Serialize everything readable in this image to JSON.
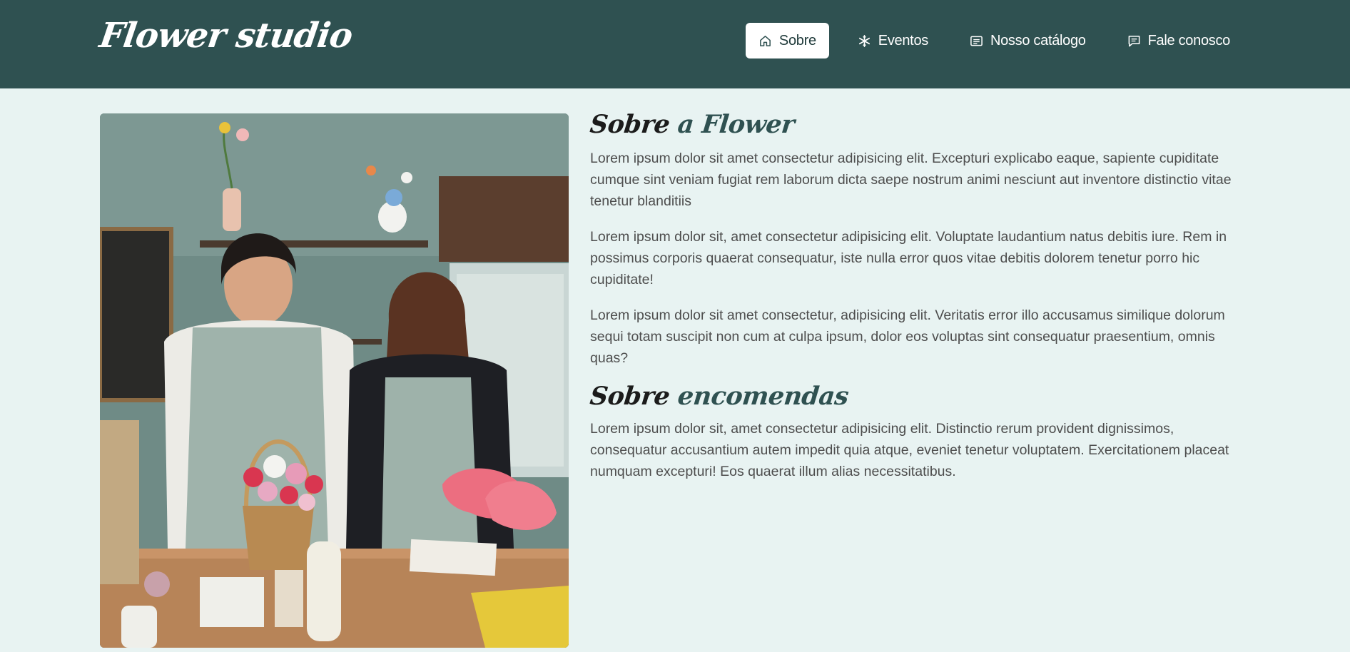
{
  "header": {
    "brand": "Flower studio",
    "nav": [
      {
        "label": "Sobre",
        "icon": "home-icon",
        "active": true
      },
      {
        "label": "Eventos",
        "icon": "snowflake-icon",
        "active": false
      },
      {
        "label": "Nosso catálogo",
        "icon": "catalog-icon",
        "active": false
      },
      {
        "label": "Fale conosco",
        "icon": "chat-icon",
        "active": false
      }
    ]
  },
  "about": {
    "title_plain": "Sobre",
    "title_accent": "a Flower",
    "paragraphs": [
      "Lorem ipsum dolor sit amet consectetur adipisicing elit. Excepturi explicabo eaque, sapiente cupiditate cumque sint veniam fugiat rem laborum dicta saepe nostrum animi nesciunt aut inventore distinctio vitae tenetur blanditiis",
      "Lorem ipsum dolor sit, amet consectetur adipisicing elit. Voluptate laudantium natus debitis iure. Rem in possimus corporis quaerat consequatur, iste nulla error quos vitae debitis dolorem tenetur porro hic cupiditate!",
      "Lorem ipsum dolor sit amet consectetur, adipisicing elit. Veritatis error illo accusamus similique dolorum sequi totam suscipit non cum at culpa ipsum, dolor eos voluptas sint consequatur praesentium, omnis quas?"
    ]
  },
  "orders": {
    "title_plain": "Sobre",
    "title_accent": "encomendas",
    "paragraphs": [
      "Lorem ipsum dolor sit, amet consectetur adipisicing elit. Distinctio rerum provident dignissimos, consequatur accusantium autem impedit quia atque, eveniet tenetur voluptatem. Exercitationem placeat numquam excepturi! Eos quaerat illum alias necessitatibus."
    ]
  },
  "colors": {
    "header_bg": "#2f5151",
    "page_bg": "#e8f3f2",
    "accent": "#2f5151"
  }
}
